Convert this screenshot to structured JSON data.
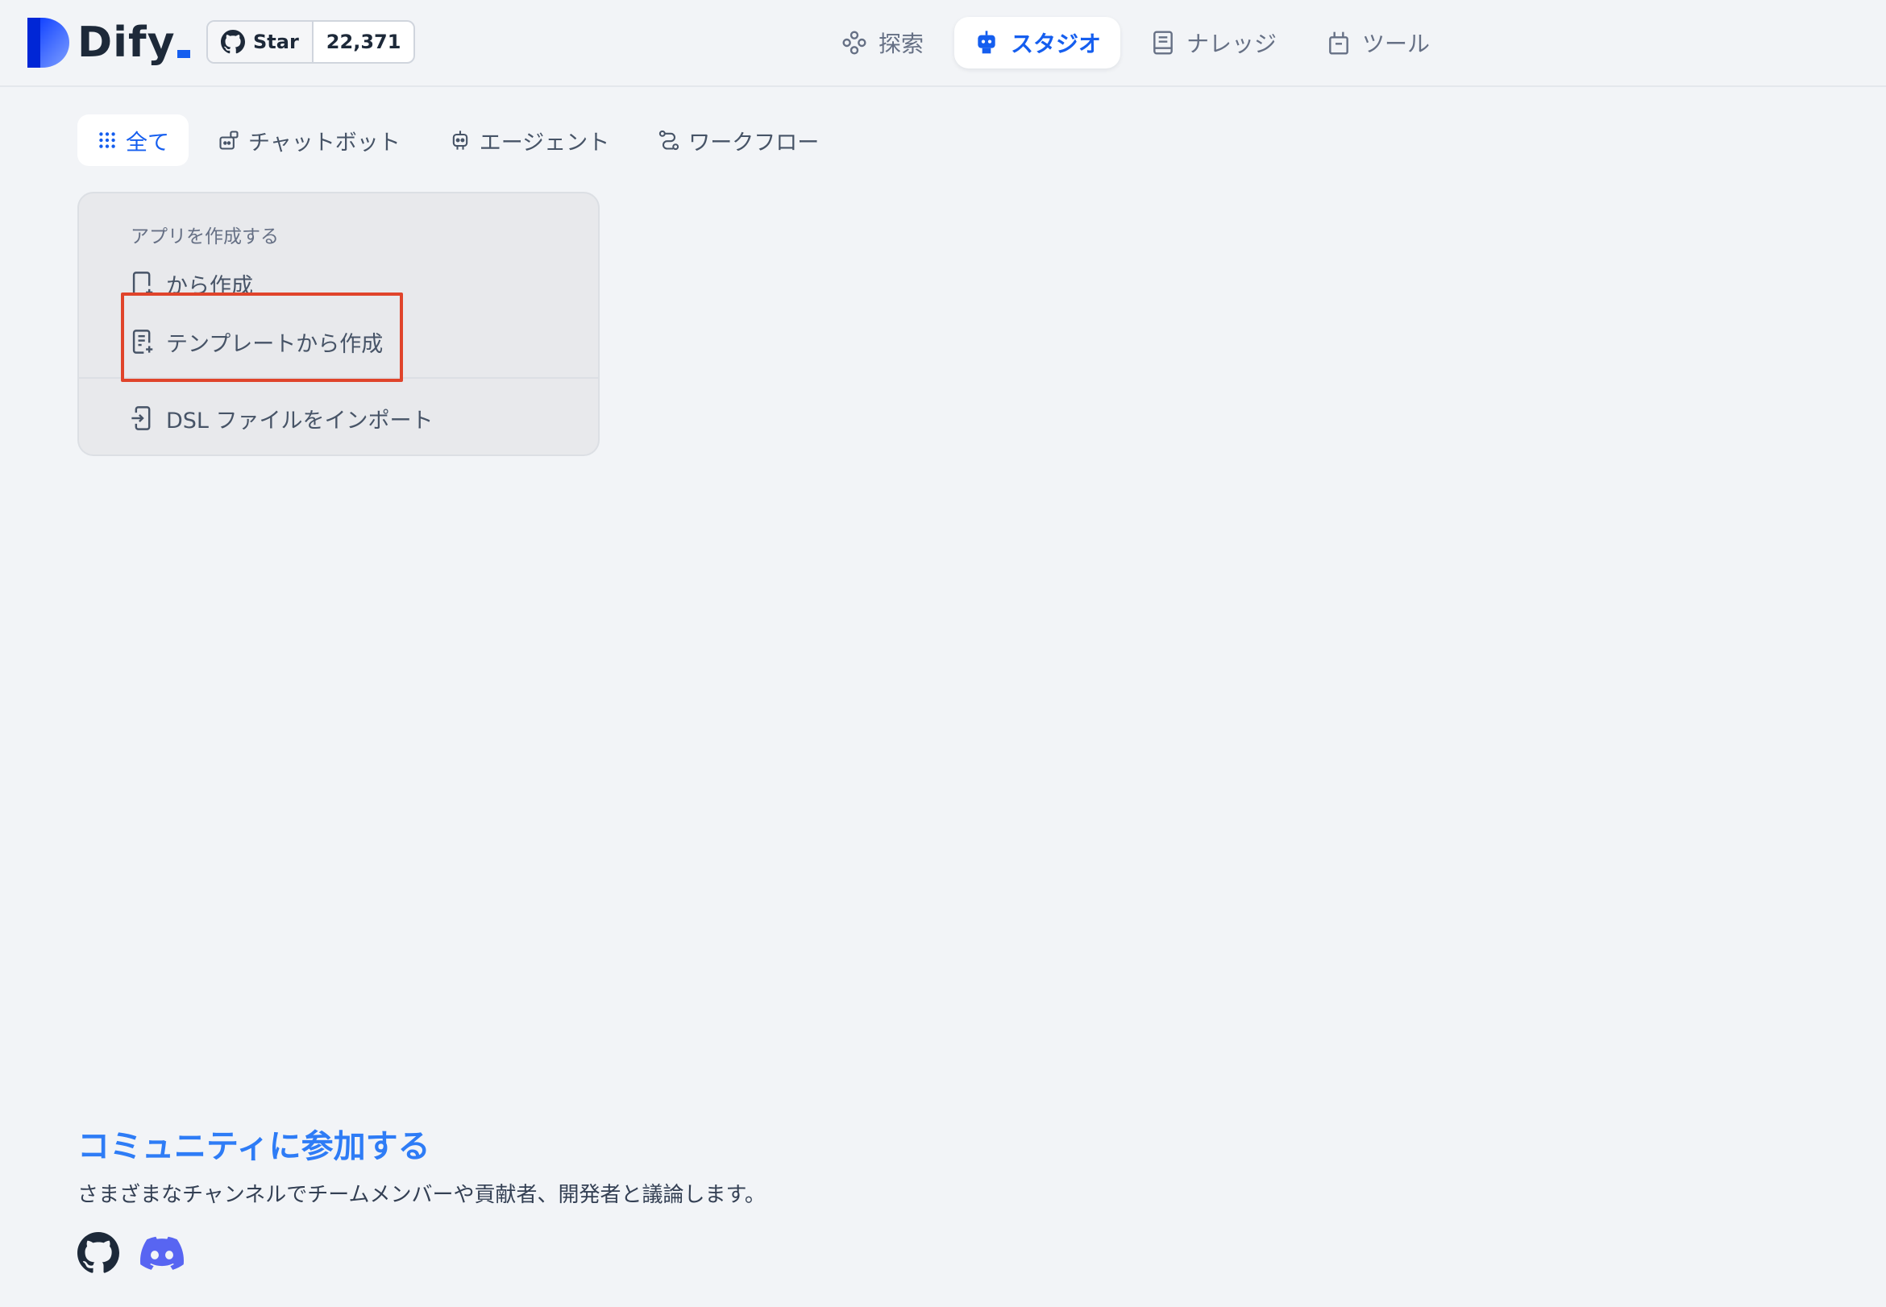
{
  "header": {
    "logo_text": "Dify",
    "github": {
      "star_label": "Star",
      "star_count": "22,371"
    },
    "nav": [
      {
        "label": "探索",
        "icon": "explore-icon",
        "active": false
      },
      {
        "label": "スタジオ",
        "icon": "robot-icon",
        "active": true
      },
      {
        "label": "ナレッジ",
        "icon": "book-icon",
        "active": false
      },
      {
        "label": "ツール",
        "icon": "toolbox-icon",
        "active": false
      }
    ]
  },
  "filters": [
    {
      "label": "全て",
      "icon": "grid-dots-icon",
      "active": true
    },
    {
      "label": "チャットボット",
      "icon": "chatbot-icon",
      "active": false
    },
    {
      "label": "エージェント",
      "icon": "agent-icon",
      "active": false
    },
    {
      "label": "ワークフロー",
      "icon": "workflow-icon",
      "active": false
    }
  ],
  "create_card": {
    "title": "アプリを作成する",
    "blank_label": "から作成",
    "template_label": "テンプレートから作成",
    "dsl_label": "DSL ファイルをインポート"
  },
  "footer": {
    "title": "コミュニティに参加する",
    "description": "さまざまなチャンネルでチームメンバーや貢献者、開発者と議論します。"
  },
  "colors": {
    "accent": "#155eef",
    "community_title": "#2e7cf6",
    "highlight": "#e0442b",
    "discord": "#5865f2"
  }
}
